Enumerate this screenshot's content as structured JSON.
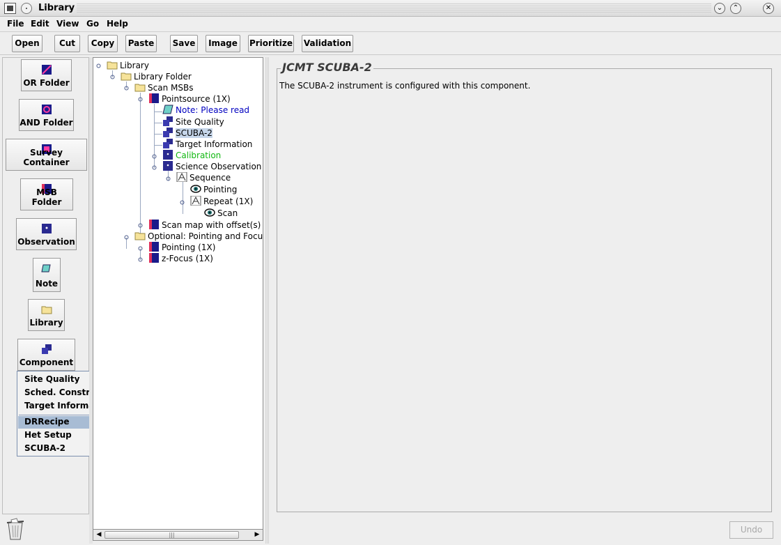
{
  "window": {
    "title": "Library"
  },
  "menubar": {
    "items": [
      "File",
      "Edit",
      "View",
      "Go",
      "Help"
    ]
  },
  "toolbar": {
    "buttons": [
      "Open",
      "Cut",
      "Copy",
      "Paste",
      "Save",
      "Image",
      "Prioritize",
      "Validation"
    ]
  },
  "palette": {
    "buttons": [
      "OR Folder",
      "AND Folder",
      "Survey Container",
      "MSB Folder",
      "Observation",
      "Note",
      "Library",
      "Component"
    ]
  },
  "popup_menu": {
    "items_top": [
      "Site Quality",
      "Sched. Constraints",
      "Target Information"
    ],
    "items_bottom": [
      "DRRecipe",
      "Het Setup",
      "SCUBA-2"
    ],
    "highlighted": "DRRecipe"
  },
  "tree": {
    "nodes": [
      {
        "label": "Library",
        "icon": "folder-icon"
      },
      {
        "label": "Library Folder",
        "icon": "folder-icon"
      },
      {
        "label": "Scan MSBs",
        "icon": "folder-icon"
      },
      {
        "label": "Pointsource (1X)",
        "icon": "msb-icon"
      },
      {
        "label": "Note: Please read",
        "icon": "note-icon",
        "color": "#0000c0"
      },
      {
        "label": "Site Quality",
        "icon": "component-icon"
      },
      {
        "label": "SCUBA-2",
        "icon": "component-icon",
        "selected": true
      },
      {
        "label": "Target Information",
        "icon": "component-icon"
      },
      {
        "label": "Calibration",
        "icon": "observation-icon",
        "color": "#11b811"
      },
      {
        "label": "Science Observation",
        "icon": "observation-icon"
      },
      {
        "label": "Sequence",
        "icon": "sequence-icon"
      },
      {
        "label": "Pointing",
        "icon": "eye-icon"
      },
      {
        "label": "Repeat (1X)",
        "icon": "sequence-icon"
      },
      {
        "label": "Scan",
        "icon": "eye-icon"
      },
      {
        "label": "Scan map with offset(s) (",
        "icon": "msb-icon"
      },
      {
        "label": "Optional: Pointing and Focus",
        "icon": "folder-icon"
      },
      {
        "label": "Pointing (1X)",
        "icon": "msb-icon"
      },
      {
        "label": "z-Focus (1X)",
        "icon": "msb-icon"
      }
    ]
  },
  "editor": {
    "title": "JCMT SCUBA-2",
    "description": "The SCUBA-2 instrument is configured with this component.",
    "undo_label": "Undo"
  }
}
